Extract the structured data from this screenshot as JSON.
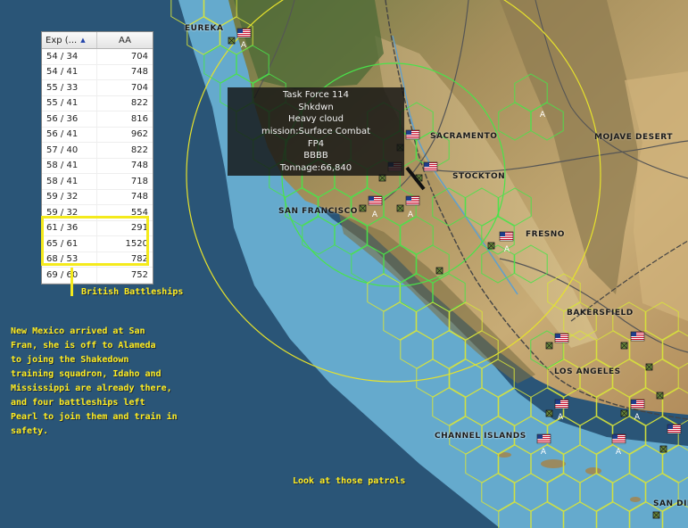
{
  "map_labels": {
    "eureka": "EUREKA",
    "sacramento": "SACRAMENTO",
    "stockton": "STOCKTON",
    "san_francisco": "SAN FRANCISCO",
    "fresno": "FRESNO",
    "mojave": "MOJAVE DESERT",
    "bakersfield": "BAKERSFIELD",
    "los_angeles": "LOS ANGELES",
    "channel_islands": "CHANNEL ISLANDS",
    "san_diego": "SAN DIE"
  },
  "table": {
    "col_exp": "Exp (...",
    "col_aa": "AA",
    "sort_icon": "sort-ascending-icon",
    "rows": [
      {
        "exp": "54 / 34",
        "aa": "704"
      },
      {
        "exp": "54 / 41",
        "aa": "748"
      },
      {
        "exp": "55 / 33",
        "aa": "704"
      },
      {
        "exp": "55 / 41",
        "aa": "822"
      },
      {
        "exp": "56 / 36",
        "aa": "816"
      },
      {
        "exp": "56 / 41",
        "aa": "962"
      },
      {
        "exp": "57 / 40",
        "aa": "822"
      },
      {
        "exp": "58 / 41",
        "aa": "748"
      },
      {
        "exp": "58 / 41",
        "aa": "718"
      },
      {
        "exp": "59 / 32",
        "aa": "748"
      },
      {
        "exp": "59 / 32",
        "aa": "554"
      },
      {
        "exp": "61 / 36",
        "aa": "291"
      },
      {
        "exp": "65 / 61",
        "aa": "1520"
      },
      {
        "exp": "68 / 53",
        "aa": "782"
      },
      {
        "exp": "69 / 60",
        "aa": "752"
      }
    ]
  },
  "annotations": {
    "british": "British Battleships",
    "new_mexico": "New Mexico arrived at San\nFran, she is off to Alameda\nto joing the Shakedown\ntraining squadron, Idaho and\nMississippi are already there,\nand four battleships left\nPearl to join them and train in\nsafety.",
    "patrols": "Look at those patrols"
  },
  "tooltip": {
    "line1": "Task Force 114",
    "line2": "Shkdwn",
    "line3": "Heavy cloud",
    "line4": "mission:Surface Combat",
    "line5": "FP4",
    "line6": "BBBB",
    "line7": "Tonnage:66,840"
  },
  "units": {
    "airbase_letter": "A",
    "flag_icon": "us-flag-icon",
    "base_icon": "base-marker-icon"
  },
  "colors": {
    "ocean_deep": "#2a5577",
    "ocean_shallow": "#6fb8d8",
    "land": "#b89a6a",
    "hex_green": "#49e34a",
    "hex_yellow": "#d8e43a",
    "annotation": "#ffee22",
    "range_circle": "#e6e22c"
  }
}
